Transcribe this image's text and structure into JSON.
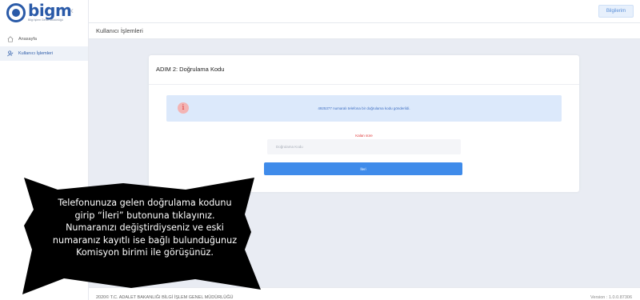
{
  "logo": {
    "text": "bigm",
    "subtitle": "Bilgi İşlem Genel Müdürlüğü"
  },
  "sidebar": {
    "items": [
      {
        "label": "Anasayfa",
        "icon": "home-icon"
      },
      {
        "label": "Kullanıcı İşlemleri",
        "icon": "user-edit-icon"
      }
    ]
  },
  "header": {
    "info_button": "Bilgilerim"
  },
  "breadcrumb": "Kullanıcı İşlemleri",
  "card": {
    "title": "ADIM 2: Doğrulama Kodu",
    "alert_text": "4925377 numaralı telefona bir doğrulama kodu gönderildi.",
    "remaining_label": "Kalan süre",
    "code_placeholder": "Doğrulama Kodu",
    "next_button": "İleri"
  },
  "footer": {
    "left": "2020© T.C. ADALET BAKANLIĞI BİLGİ İŞLEM GENEL MÜDÜRLÜĞÜ",
    "right": "Version : 1.0.0.87306"
  },
  "callout": {
    "lines": [
      "Telefonunuza gelen doğrulama kodunu",
      "girip “İleri” butonuna tıklayınız.",
      "Numaranızı değiştirdiyseniz ve eski",
      "numaranız kayıtlı ise bağlı bulunduğunuz",
      "Komisyon birimi ile görüşünüz."
    ]
  },
  "colors": {
    "brand": "#2a5aa8",
    "primary_button": "#3f8bea",
    "alert_bg": "#dce9fb",
    "countdown": "#e03b3b",
    "callout_bg": "#000000"
  }
}
